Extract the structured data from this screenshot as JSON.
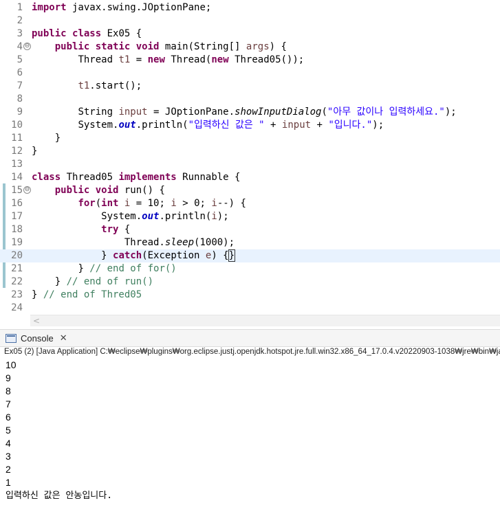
{
  "editor": {
    "lines": [
      {
        "n": "1",
        "fold": false
      },
      {
        "n": "2",
        "fold": false
      },
      {
        "n": "3",
        "fold": false
      },
      {
        "n": "4",
        "fold": true
      },
      {
        "n": "5",
        "fold": false
      },
      {
        "n": "6",
        "fold": false
      },
      {
        "n": "7",
        "fold": false
      },
      {
        "n": "8",
        "fold": false
      },
      {
        "n": "9",
        "fold": false
      },
      {
        "n": "10",
        "fold": false
      },
      {
        "n": "11",
        "fold": false
      },
      {
        "n": "12",
        "fold": false
      },
      {
        "n": "13",
        "fold": false
      },
      {
        "n": "14",
        "fold": false
      },
      {
        "n": "15",
        "fold": true
      },
      {
        "n": "16",
        "fold": false
      },
      {
        "n": "17",
        "fold": false
      },
      {
        "n": "18",
        "fold": false
      },
      {
        "n": "19",
        "fold": false
      },
      {
        "n": "20",
        "fold": false
      },
      {
        "n": "21",
        "fold": false
      },
      {
        "n": "22",
        "fold": false
      },
      {
        "n": "23",
        "fold": false
      },
      {
        "n": "24",
        "fold": false
      }
    ],
    "fold_glyph": "⊖",
    "current_line": "20",
    "code": {
      "l1": {
        "kw": "import",
        "rest": " javax.swing.JOptionPane;"
      },
      "l3": {
        "kw1": "public",
        "kw2": "class",
        "rest": " Ex05 {"
      },
      "l4": {
        "kw1": "public",
        "kw2": "static",
        "kw3": "void",
        "a": " main(String[] ",
        "param": "args",
        "b": ") {"
      },
      "l5": {
        "a": "Thread ",
        "var": "t1",
        "b": " = ",
        "kw": "new",
        "c": " Thread(",
        "kw2": "new",
        "d": " Thread05());"
      },
      "l7": {
        "var": "t1",
        "a": ".start();"
      },
      "l9": {
        "a": "String ",
        "var": "input",
        "b": " = JOptionPane.",
        "method": "showInputDialog",
        "c": "(",
        "str": "\"아무 값이나 입력하세요.\"",
        "d": ");"
      },
      "l10": {
        "a": "System.",
        "fld": "out",
        "b": ".println(",
        "str1": "\"입력하신 값은 \"",
        "c": " + ",
        "var": "input",
        "d": " + ",
        "str2": "\"입니다.\"",
        "e": ");"
      },
      "l11": "}",
      "l12": "}",
      "l14": {
        "kw1": "class",
        "a": " Thread05 ",
        "kw2": "implements",
        "b": " Runnable {"
      },
      "l15": {
        "kw1": "public",
        "kw2": "void",
        "a": " run() {"
      },
      "l16": {
        "kw1": "for",
        "a": "(",
        "kw2": "int",
        "b": " ",
        "var": "i",
        "c": " = 10; ",
        "var2": "i",
        "d": " > 0; ",
        "var3": "i",
        "e": "--) {"
      },
      "l17": {
        "a": "System.",
        "fld": "out",
        "b": ".println(",
        "var": "i",
        "c": ");"
      },
      "l18": {
        "kw": "try",
        "a": " {"
      },
      "l19": {
        "a": "Thread.",
        "method": "sleep",
        "b": "(1000);"
      },
      "l20": {
        "a": "} ",
        "kw": "catch",
        "b": "(Exception ",
        "var": "e",
        "c": ") {",
        "br": "}"
      },
      "l21": {
        "a": "} ",
        "cmt": "// end of for()"
      },
      "l22": {
        "a": "} ",
        "cmt": "// end of run()"
      },
      "l23": {
        "a": "} ",
        "cmt": "// end of Thred05"
      }
    }
  },
  "scrollbar": {
    "left_arrow": "<"
  },
  "console": {
    "tab_label": "Console",
    "close_glyph": "✕",
    "description": "Ex05 (2) [Java Application] C:₩eclipse₩plugins₩org.eclipse.justj.openjdk.hotspot.jre.full.win32.x86_64_17.0.4.v20220903-1038₩jre₩bin₩javaw.exe",
    "output": [
      "10",
      "9",
      "8",
      "7",
      "6",
      "5",
      "4",
      "3",
      "2",
      "1"
    ],
    "final_line": "입력하신 값은 안농입니다."
  }
}
